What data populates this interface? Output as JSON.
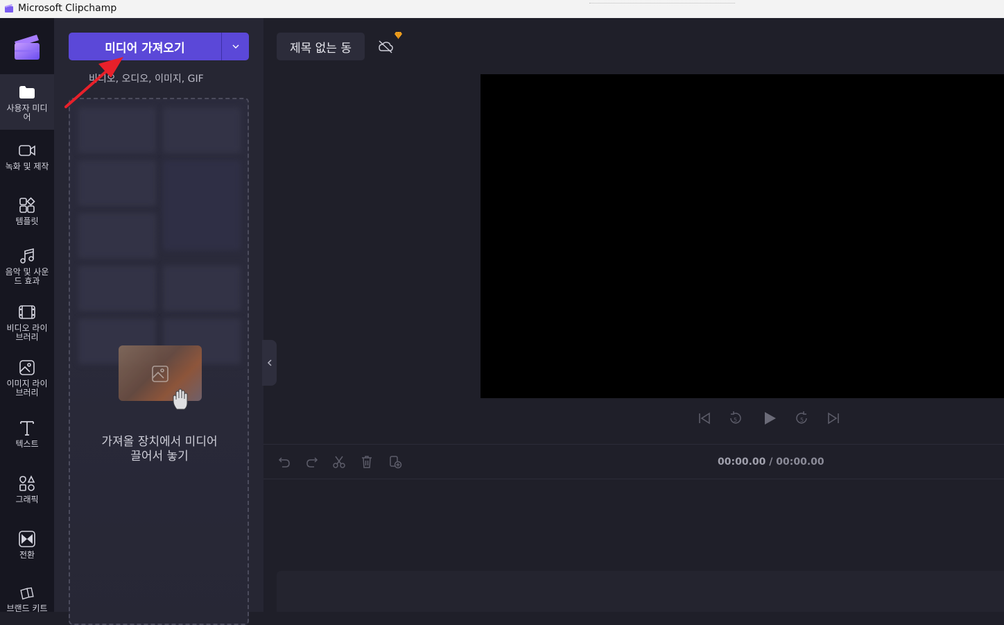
{
  "window": {
    "title": "Microsoft Clipchamp"
  },
  "rail": {
    "items": [
      {
        "label": "사용자 미디\n어",
        "icon": "folder-icon",
        "active": true
      },
      {
        "label": "녹화 및 제작",
        "icon": "video-camera-icon"
      },
      {
        "label": "템플릿",
        "icon": "templates-icon"
      },
      {
        "label": "음악 및 사운\n드 효과",
        "icon": "music-note-icon"
      },
      {
        "label": "비디오 라이\n브러리",
        "icon": "film-icon"
      },
      {
        "label": "이미지 라이\n브러리",
        "icon": "image-icon"
      },
      {
        "label": "텍스트",
        "icon": "text-icon"
      },
      {
        "label": "그래픽",
        "icon": "shapes-icon"
      },
      {
        "label": "전환",
        "icon": "transition-icon"
      },
      {
        "label": "브랜드 키트",
        "icon": "brand-kit-icon"
      }
    ]
  },
  "media_panel": {
    "import_button": "미디어 가져오기",
    "media_types": "비디오, 오디오, 이미지, GIF",
    "drop_text": "가져올 장치에서 미디어\n끌어서 놓기"
  },
  "project": {
    "title": "제목 없는 동"
  },
  "timeline": {
    "current_time": "00:00.00",
    "separator": " / ",
    "total_time": "00:00.00"
  },
  "colors": {
    "accent": "#5b48d8",
    "annotation_arrow": "#e8202a",
    "premium": "#f5a623"
  }
}
